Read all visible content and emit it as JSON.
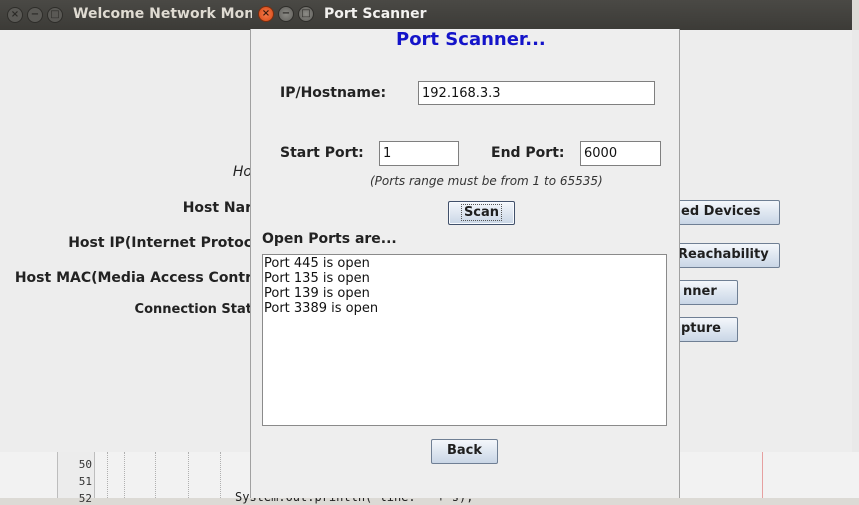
{
  "background_window": {
    "title": "Welcome Network Moni",
    "labels": [
      "Ho",
      "Host Nar",
      "Host IP(Internet Protoc",
      "Host MAC(Media Access Contr",
      "Connection Stat"
    ],
    "buttons": [
      "ed Devices",
      "Reachability",
      "nner",
      "pture"
    ]
  },
  "ide": {
    "line_numbers": [
      "50",
      "51",
      "52"
    ],
    "code_line": "System.out.println(\"line: \" + s);"
  },
  "dialog": {
    "window_title": "Port Scanner",
    "heading": "Port Scanner...",
    "ip_label": "IP/Hostname:",
    "ip_value": "192.168.3.3",
    "start_port_label": "Start Port:",
    "start_port_value": "1",
    "end_port_label": "End Port:",
    "end_port_value": "6000",
    "range_hint": "(Ports range must be from 1 to 65535)",
    "scan_button": "Scan",
    "open_ports_label": "Open Ports are...",
    "open_ports": [
      "Port 445 is open",
      "Port 135 is open",
      "Port 139 is open",
      "Port 3389 is open"
    ],
    "back_button": "Back"
  },
  "colors": {
    "heading": "#1313c9",
    "titlebar": "#3c3b37",
    "close_button": "#e05a24",
    "button_gradient_top": "#f4f7fb",
    "button_gradient_bottom": "#c9d6e6"
  }
}
